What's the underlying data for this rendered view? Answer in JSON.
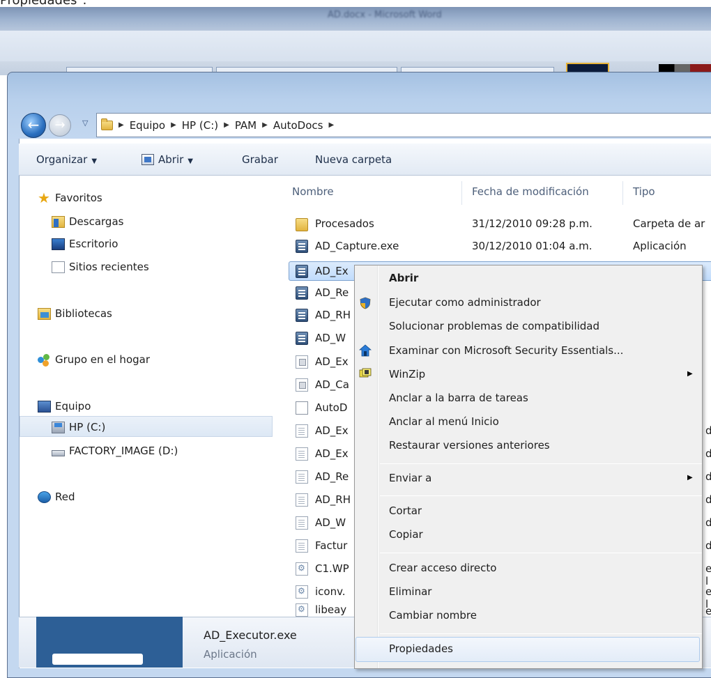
{
  "caption": "Propiedades\".",
  "background_window": {
    "title": "AD.docx - Microsoft Word"
  },
  "nav": {
    "back": "back",
    "forward": "forward",
    "breadcrumb": [
      "Equipo",
      "HP (C:)",
      "PAM",
      "AutoDocs"
    ]
  },
  "toolbar": {
    "organizar": "Organizar",
    "abrir": "Abrir",
    "grabar": "Grabar",
    "nueva_carpeta": "Nueva carpeta"
  },
  "sidebar": {
    "favoritos": "Favoritos",
    "descargas": "Descargas",
    "escritorio": "Escritorio",
    "sitios": "Sitios recientes",
    "bibliotecas": "Bibliotecas",
    "grupo": "Grupo en el hogar",
    "equipo": "Equipo",
    "hp": "HP (C:)",
    "factory": "FACTORY_IMAGE (D:)",
    "red": "Red"
  },
  "columns": {
    "nombre": "Nombre",
    "fecha": "Fecha de modificación",
    "tipo": "Tipo"
  },
  "files": [
    {
      "name": "Procesados",
      "date": "31/12/2010 09:28 p.m.",
      "type": "Carpeta de ar"
    },
    {
      "name": "AD_Capture.exe",
      "date": "30/12/2010 01:04 a.m.",
      "type": "Aplicación"
    },
    {
      "name": "AD_Ex"
    },
    {
      "name": "AD_Re"
    },
    {
      "name": "AD_RH"
    },
    {
      "name": "AD_W"
    },
    {
      "name": "AD_Ex"
    },
    {
      "name": "AD_Ca"
    },
    {
      "name": "AutoD"
    },
    {
      "name": "AD_Ex",
      "tail": "d"
    },
    {
      "name": "AD_Ex",
      "tail": "d"
    },
    {
      "name": "AD_Re",
      "tail": "d"
    },
    {
      "name": "AD_RH",
      "tail": "d"
    },
    {
      "name": "AD_W",
      "tail": "d"
    },
    {
      "name": "Factur",
      "tail": "d"
    },
    {
      "name": "C1.WP",
      "tail": "e l"
    },
    {
      "name": "iconv.",
      "tail": "e l"
    },
    {
      "name": "libeay",
      "tail": "e l"
    }
  ],
  "context_menu": {
    "abrir": "Abrir",
    "ejecutar": "Ejecutar como administrador",
    "solucionar": "Solucionar problemas de compatibilidad",
    "examinar": "Examinar con Microsoft Security Essentials...",
    "winzip": "WinZip",
    "anclar_barra": "Anclar a la barra de tareas",
    "anclar_inicio": "Anclar al menú Inicio",
    "restaurar": "Restaurar versiones anteriores",
    "enviar": "Enviar a",
    "cortar": "Cortar",
    "copiar": "Copiar",
    "crear_acceso": "Crear acceso directo",
    "eliminar": "Eliminar",
    "cambiar_nombre": "Cambiar nombre",
    "propiedades": "Propiedades"
  },
  "details": {
    "name": "AD_Executor.exe",
    "type": "Aplicación"
  }
}
